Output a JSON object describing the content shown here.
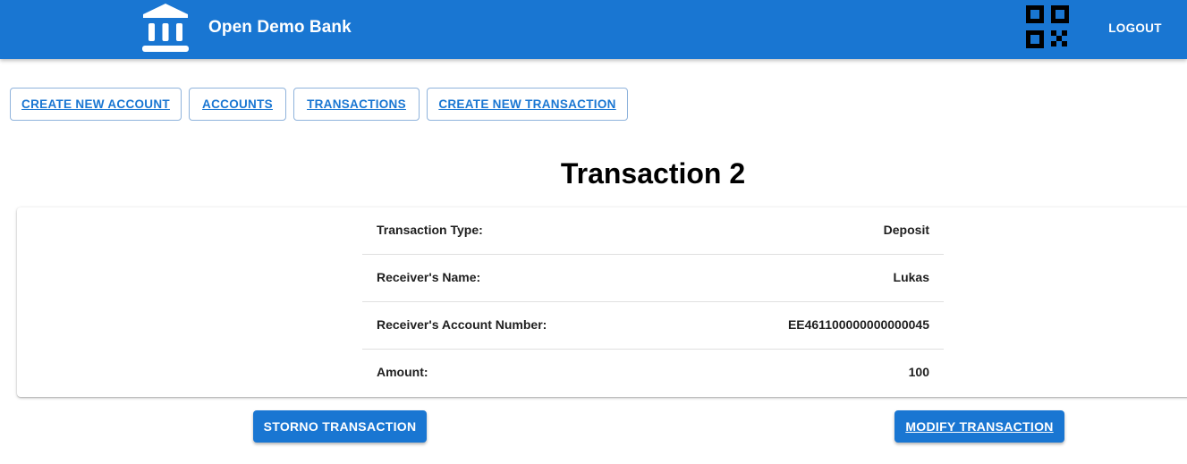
{
  "appbar": {
    "brand": "Open Demo Bank",
    "logo_icon": "bank-icon",
    "qr_icon": "qr-code-icon",
    "logout_label": "LOGOUT",
    "color": "#1976d2"
  },
  "nav": {
    "create_account": "CREATE NEW ACCOUNT",
    "accounts": "ACCOUNTS",
    "transactions": "TRANSACTIONS",
    "create_transaction": "CREATE NEW TRANSACTION"
  },
  "page": {
    "title": "Transaction 2"
  },
  "details": [
    {
      "label": "Transaction Type:",
      "value": "Deposit"
    },
    {
      "label": "Receiver's Name:",
      "value": "Lukas"
    },
    {
      "label": "Receiver's Account Number:",
      "value": "EE461100000000000045"
    },
    {
      "label": "Amount:",
      "value": "100"
    }
  ],
  "actions": {
    "storno": "STORNO TRANSACTION",
    "modify": "MODIFY TRANSACTION"
  }
}
